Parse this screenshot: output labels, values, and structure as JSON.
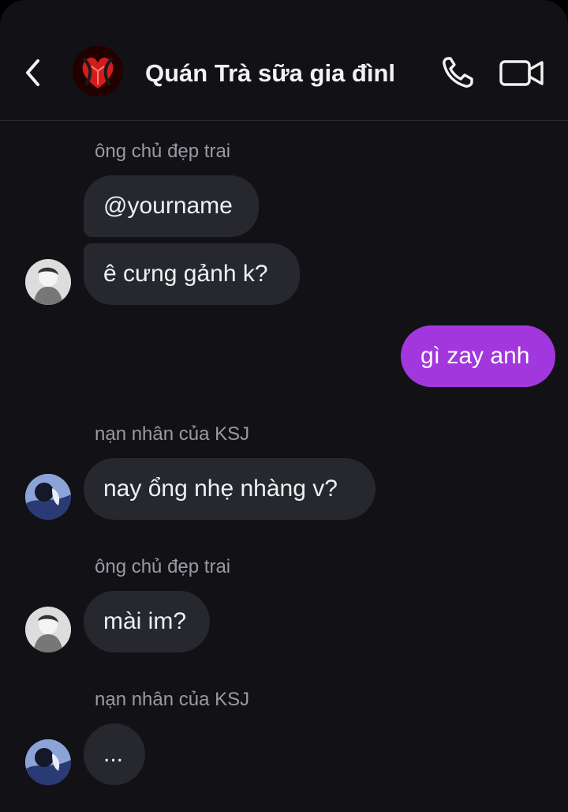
{
  "header": {
    "title": "Quán Trà sữa gia đìnl"
  },
  "messages": [
    {
      "sender": "ông chủ đẹp trai"
    },
    {
      "text": "@yourname"
    },
    {
      "text": "ê cưng gảnh k?"
    },
    {
      "text": "gì zay anh"
    },
    {
      "sender": "nạn nhân của KSJ"
    },
    {
      "text": "nay ổng nhẹ nhàng v?"
    },
    {
      "sender": "ông chủ đẹp trai"
    },
    {
      "text": "mài im?"
    },
    {
      "sender": "nạn nhân của KSJ"
    },
    {
      "text": "..."
    }
  ],
  "colors": {
    "background": "#111116",
    "incoming_bubble": "#27282d",
    "outgoing_bubble": "#a237de",
    "text": "#eef0f4",
    "secondary_text": "#9a9aa2"
  },
  "icons": [
    "back-arrow-icon",
    "group-avatar",
    "phone-icon",
    "video-call-icon",
    "contact-avatar"
  ]
}
